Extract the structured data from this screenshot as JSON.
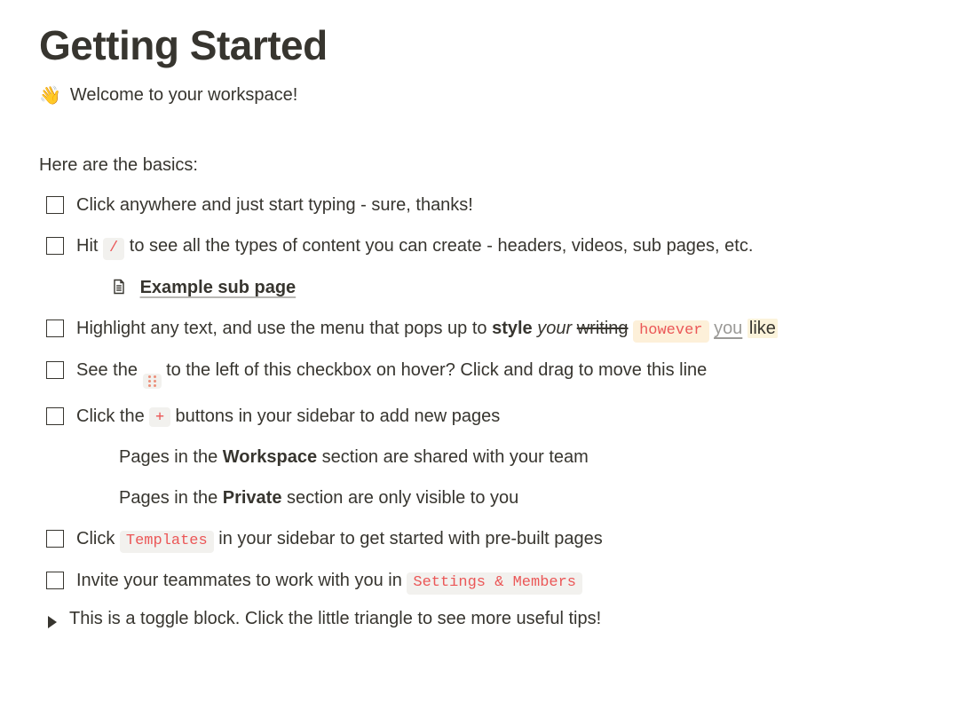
{
  "title": "Getting Started",
  "welcome_emoji": "👋",
  "welcome_text": "Welcome to your workspace!",
  "basics_heading": "Here are the basics:",
  "items": {
    "i1": "Click anywhere and just start typing - sure, thanks!",
    "i2_pre": "Hit ",
    "i2_key": "/",
    "i2_post": " to see all the types of content you can create - headers, videos, sub pages, etc.",
    "subpage_label": "Example sub page",
    "i3_pre": "Highlight any text, and use the menu that pops up to ",
    "i3_bold": "style",
    "i3_sp1": " ",
    "i3_italic": "your",
    "i3_sp2": " ",
    "i3_strike": "writing",
    "i3_sp3": "  ",
    "i3_code": "however",
    "i3_sp4": "  ",
    "i3_gray": "you",
    "i3_sp5": " ",
    "i3_hl": "like",
    "i4_pre": "See the ",
    "i4_post": " to the left of this checkbox on hover? Click and drag to move this line",
    "i5_pre": "Click the ",
    "i5_plus": "+",
    "i5_post": " buttons in your sidebar to add new pages",
    "i5_sub1_pre": "Pages in the ",
    "i5_sub1_bold": "Workspace",
    "i5_sub1_post": " section are shared with your team",
    "i5_sub2_pre": "Pages in the ",
    "i5_sub2_bold": "Private",
    "i5_sub2_post": " section are only visible to you",
    "i6_pre": "Click ",
    "i6_code": "Templates",
    "i6_post": " in your sidebar to get started with pre-built pages",
    "i7_pre": "Invite your teammates to work with you in ",
    "i7_code": "Settings & Members",
    "toggle_text": "This is a toggle block. Click the little triangle to see more useful tips!"
  }
}
